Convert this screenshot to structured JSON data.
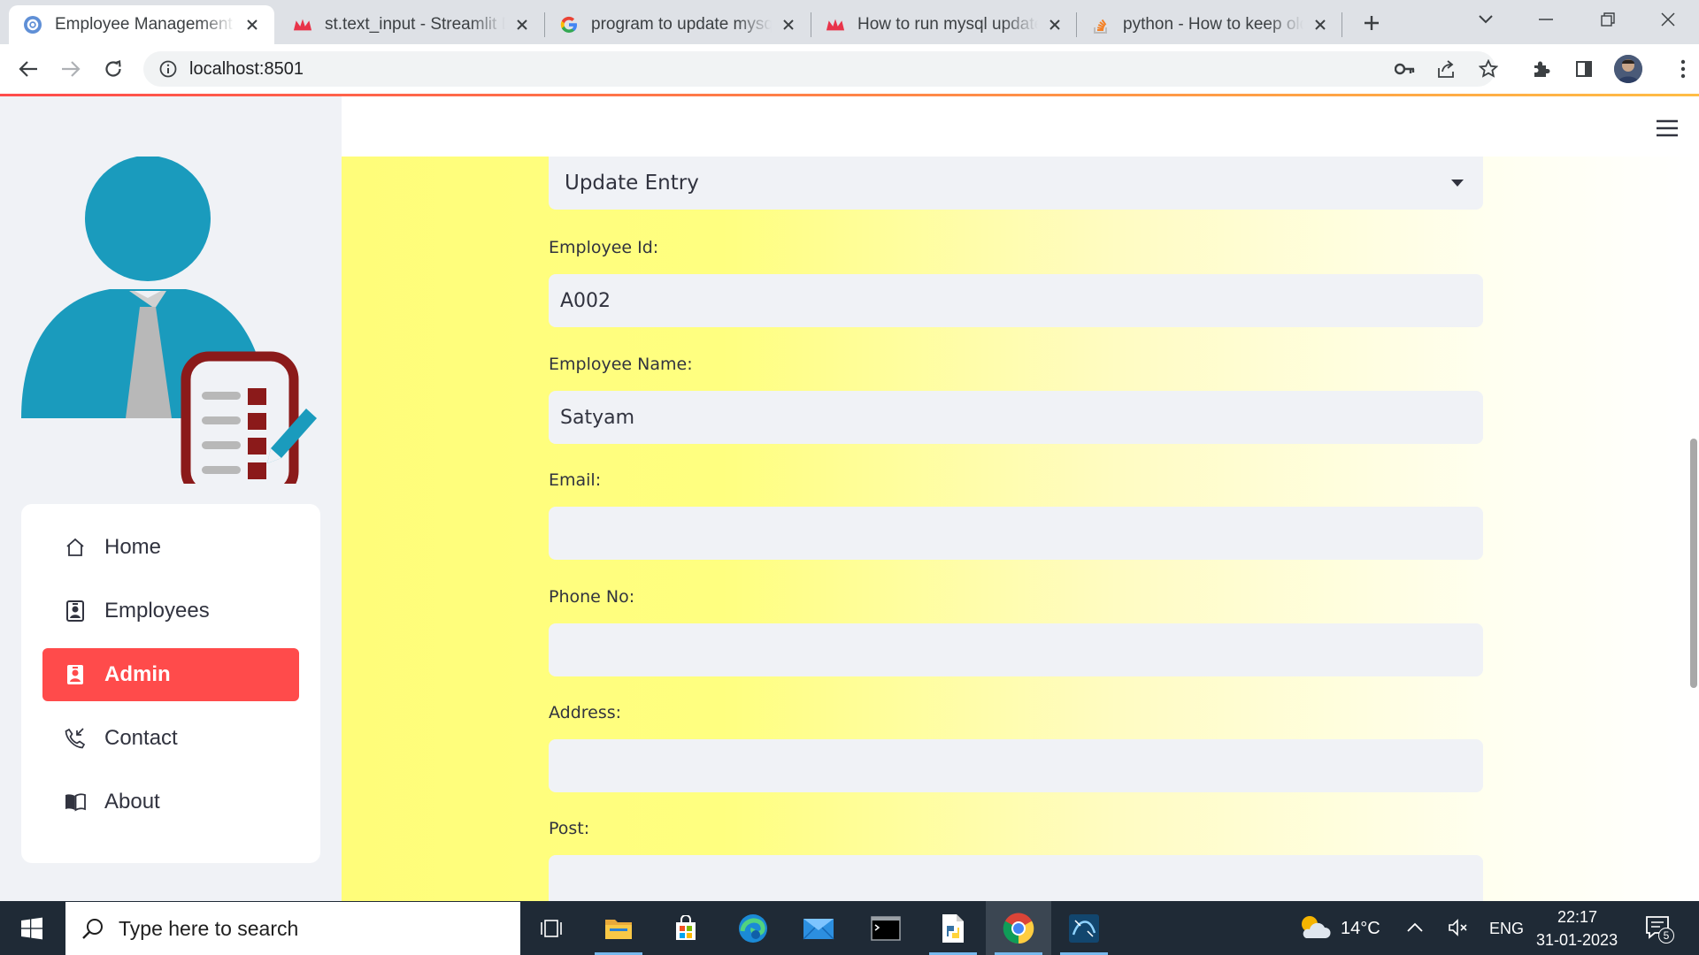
{
  "browser": {
    "tabs": [
      {
        "title": "Employee Management System",
        "favicon": "streamlit-gear-icon",
        "active": true
      },
      {
        "title": "st.text_input - Streamlit Docs",
        "favicon": "streamlit-crown-icon",
        "active": false
      },
      {
        "title": "program to update mysql table",
        "favicon": "google-icon",
        "active": false
      },
      {
        "title": "How to run mysql update query",
        "favicon": "streamlit-crown-icon",
        "active": false
      },
      {
        "title": "python - How to keep old values",
        "favicon": "stackoverflow-icon",
        "active": false
      }
    ],
    "url": "localhost:8501"
  },
  "sidebar": {
    "menu": [
      {
        "label": "Home",
        "icon": "house-icon",
        "active": false
      },
      {
        "label": "Employees",
        "icon": "person-badge-icon",
        "active": false
      },
      {
        "label": "Admin",
        "icon": "person-badge-icon",
        "active": true
      },
      {
        "label": "Contact",
        "icon": "telephone-icon",
        "active": false
      },
      {
        "label": "About",
        "icon": "book-icon",
        "active": false
      }
    ]
  },
  "form": {
    "action_select": {
      "value": "Update Entry"
    },
    "fields": [
      {
        "label": "Employee Id:",
        "value": "A002"
      },
      {
        "label": "Employee Name:",
        "value": "Satyam"
      },
      {
        "label": "Email:",
        "value": ""
      },
      {
        "label": "Phone No:",
        "value": ""
      },
      {
        "label": "Address:",
        "value": ""
      },
      {
        "label": "Post:",
        "value": ""
      }
    ]
  },
  "taskbar": {
    "search_placeholder": "Type here to search",
    "weather": "14°C",
    "language": "ENG",
    "time": "22:17",
    "date": "31-01-2023",
    "notifications": "5"
  },
  "colors": {
    "accent": "#ff4b4b",
    "sidebar_bg": "#f0f2f6",
    "main_gradient_start": "#fffd7a",
    "hero_blue": "#1a9bbd",
    "hero_dark_red": "#8b1a1a"
  }
}
